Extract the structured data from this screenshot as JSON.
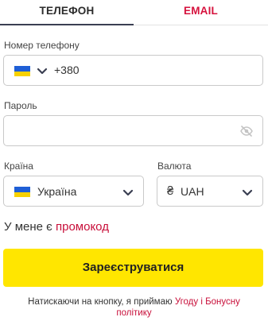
{
  "tabs": {
    "phone": "ТЕЛЕФОН",
    "email": "EMAIL"
  },
  "phone": {
    "label": "Номер телефону",
    "country_code": "+380"
  },
  "password": {
    "label": "Пароль",
    "value": ""
  },
  "country": {
    "label": "Країна",
    "value": "Україна"
  },
  "currency": {
    "label": "Валюта",
    "symbol": "₴",
    "value": "UAH"
  },
  "promo": {
    "prefix": "У мене є",
    "link": "промокод"
  },
  "submit_label": "Зареєструватися",
  "terms": {
    "text": "Натискаючи на кнопку, я приймаю",
    "link": "Угоду і Бонусну політику"
  },
  "colors": {
    "accent_red": "#d6123d",
    "button_yellow": "#ffe600",
    "flag_blue": "#1f5fd6",
    "flag_yellow": "#f7d100"
  },
  "icons": [
    "ukraine-flag-icon",
    "chevron-down-icon",
    "eye-off-icon"
  ]
}
